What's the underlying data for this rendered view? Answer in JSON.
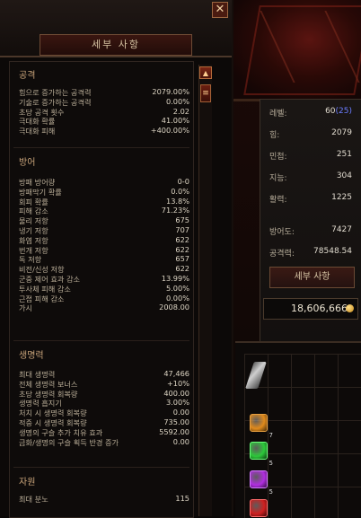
{
  "panel": {
    "title": "세부 사항",
    "close_label": "✕",
    "scroll_up": "▲",
    "scroll_thumb": "≡"
  },
  "sections": [
    {
      "title": "공격",
      "rows": [
        {
          "label": "힘으로 증가하는 공격력",
          "value": "2079.00%"
        },
        {
          "label": "기술로 증가하는 공격력",
          "value": "0.00%"
        },
        {
          "label": "초당 공격 횟수",
          "value": "2.02"
        },
        {
          "label": "극대화 확률",
          "value": "41.00%"
        },
        {
          "label": "극대화 피해",
          "value": "+400.00%"
        }
      ]
    },
    {
      "title": "방어",
      "rows": [
        {
          "label": "방패 방어량",
          "value": "0-0"
        },
        {
          "label": "방패막기 확률",
          "value": "0.0%"
        },
        {
          "label": "회피 확률",
          "value": "13.8%"
        },
        {
          "label": "피해 감소",
          "value": "71.23%"
        },
        {
          "label": "물리 저항",
          "value": "675"
        },
        {
          "label": "냉기 저항",
          "value": "707"
        },
        {
          "label": "화염 저항",
          "value": "622"
        },
        {
          "label": "번개 저항",
          "value": "622"
        },
        {
          "label": "독 저항",
          "value": "657"
        },
        {
          "label": "비전/신성 저항",
          "value": "622"
        },
        {
          "label": "군중 제어 효과 감소",
          "value": "13.99%"
        },
        {
          "label": "투사체 피해 감소",
          "value": "5.00%"
        },
        {
          "label": "근접 피해 감소",
          "value": "0.00%"
        },
        {
          "label": "가시",
          "value": "2008.00"
        }
      ]
    },
    {
      "title": "생명력",
      "rows": [
        {
          "label": "최대 생명력",
          "value": "47,466"
        },
        {
          "label": "전체 생명력 보너스",
          "value": "+10%"
        },
        {
          "label": "초당 생명력 회복량",
          "value": "400.00"
        },
        {
          "label": "생명력 흡지기",
          "value": "3.00%"
        },
        {
          "label": "처치 시 생명력 회복량",
          "value": "0.00"
        },
        {
          "label": "적중 시 생명력 회복량",
          "value": "735.00"
        },
        {
          "label": "생명의 구슬 추가 치유 효과",
          "value": "5592.00"
        },
        {
          "label": "금화/생명의 구슬 획득 반경 증가",
          "value": "0.00"
        }
      ]
    },
    {
      "title": "자원",
      "rows": [
        {
          "label": "최대 분노",
          "value": "115"
        }
      ]
    }
  ],
  "character": {
    "level_label": "레벨:",
    "level": "60",
    "paragon": "(25)",
    "stats": [
      {
        "label": "힘:",
        "value": "2079"
      },
      {
        "label": "민첩:",
        "value": "251"
      },
      {
        "label": "지능:",
        "value": "304"
      },
      {
        "label": "활력:",
        "value": "1225"
      }
    ],
    "armor_label": "방어도:",
    "armor": "7427",
    "damage_label": "공격력:",
    "damage": "78548.54",
    "detail_button": "세부 사항",
    "gold": "18,606,666"
  },
  "inventory": {
    "items": [
      {
        "name": "orange-gem",
        "color": "#e08a1c",
        "count": "7"
      },
      {
        "name": "green-gem",
        "color": "#2cc83a",
        "count": "5"
      },
      {
        "name": "purple-gem",
        "color": "#b02ee0",
        "count": "5"
      },
      {
        "name": "red-gem",
        "color": "#d02020",
        "count": ""
      }
    ]
  }
}
